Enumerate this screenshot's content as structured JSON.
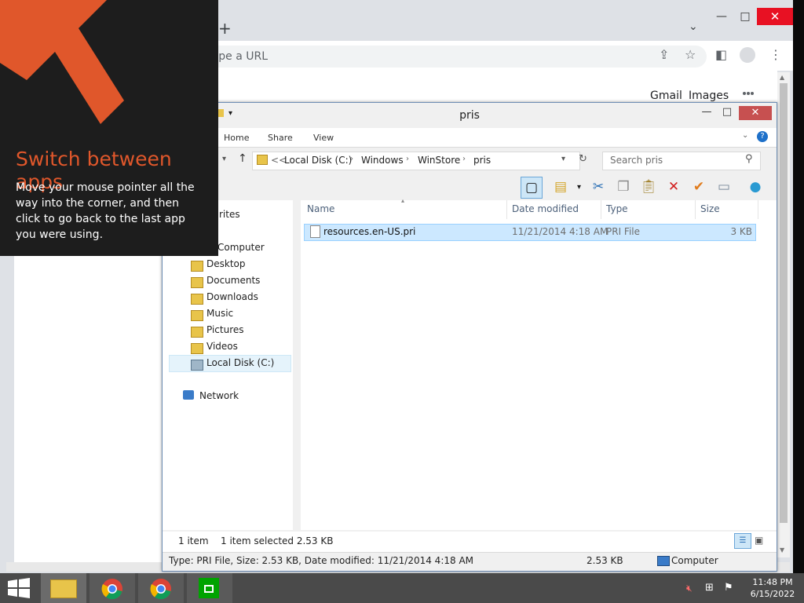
{
  "chrome": {
    "omnibox_placeholder": "ype a URL",
    "links": {
      "gmail": "Gmail",
      "images": "Images"
    }
  },
  "overlay": {
    "heading": "Switch between apps",
    "body": "Move your mouse pointer all the way into the corner, and then click to go back to the last app you were using."
  },
  "explorer": {
    "title": "pris",
    "ribbon_tabs": [
      "Home",
      "Share",
      "View"
    ],
    "breadcrumb": [
      "<<",
      "Local Disk (C:)",
      "Windows",
      "WinStore",
      "pris"
    ],
    "search_placeholder": "Search pris",
    "nav": {
      "favorites": "rites",
      "computer": "Computer",
      "items": [
        "Desktop",
        "Documents",
        "Downloads",
        "Music",
        "Pictures",
        "Videos",
        "Local Disk (C:)"
      ],
      "network": "Network"
    },
    "columns": [
      "Name",
      "Date modified",
      "Type",
      "Size"
    ],
    "files": [
      {
        "name": "resources.en-US.pri",
        "date_modified": "11/21/2014 4:18 AM",
        "type": "PRI File",
        "size": "3 KB"
      }
    ],
    "status": {
      "count": "1 item",
      "selected": "1 item selected  2.53 KB"
    },
    "details": {
      "info": "Type: PRI File, Size: 2.53 KB, Date modified: 11/21/2014 4:18 AM",
      "size": "2.53 KB",
      "location": "Computer"
    }
  },
  "taskbar": {
    "time": "11:48 PM",
    "date": "6/15/2022"
  },
  "colors": {
    "accent_orange": "#e0572b",
    "selection": "#cce8ff",
    "close_red": "#c75050"
  }
}
